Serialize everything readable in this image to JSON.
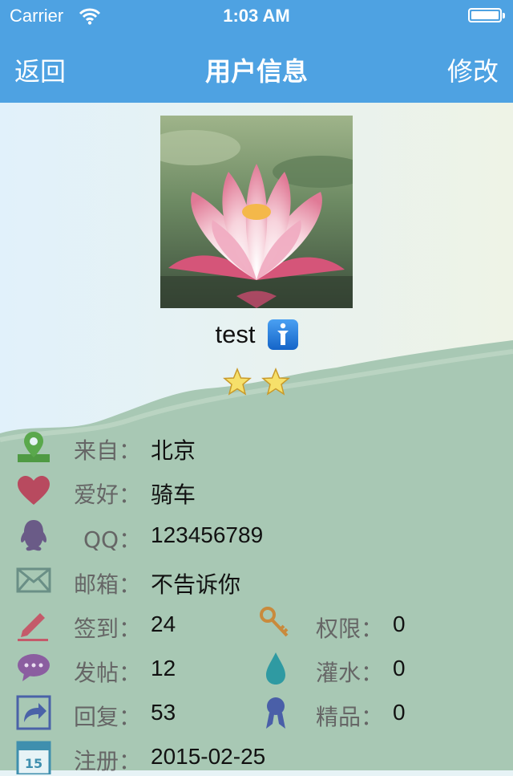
{
  "status_bar": {
    "carrier": "Carrier",
    "time": "1:03 AM"
  },
  "nav": {
    "back_label": "返回",
    "title": "用户信息",
    "edit_label": "修改"
  },
  "profile": {
    "username": "test",
    "star_count": 2
  },
  "info": {
    "from": {
      "label": "来自：",
      "value": "北京",
      "icon": "location-icon"
    },
    "hobby": {
      "label": "爱好：",
      "value": "骑车",
      "icon": "heart-icon"
    },
    "qq": {
      "label": "QQ：",
      "value": "123456789",
      "icon": "qq-penguin-icon"
    },
    "email": {
      "label": "邮箱：",
      "value": "不告诉你",
      "icon": "mail-icon"
    },
    "signin": {
      "label": "签到：",
      "value": "24",
      "icon": "pencil-icon"
    },
    "permission": {
      "label": "权限：",
      "value": "0",
      "icon": "key-icon"
    },
    "posts": {
      "label": "发帖：",
      "value": "12",
      "icon": "chat-bubble-icon"
    },
    "water": {
      "label": "灌水：",
      "value": "0",
      "icon": "water-drop-icon"
    },
    "replies": {
      "label": "回复：",
      "value": "53",
      "icon": "reply-arrow-icon"
    },
    "featured": {
      "label": "精品：",
      "value": "0",
      "icon": "ribbon-award-icon"
    },
    "registered": {
      "label": "注册：",
      "value": "2015-02-25",
      "icon": "calendar-icon"
    }
  },
  "colors": {
    "nav_bar": "#4ea2e2",
    "sky": "#e7f3f6",
    "hill": "#a8c8b4"
  }
}
